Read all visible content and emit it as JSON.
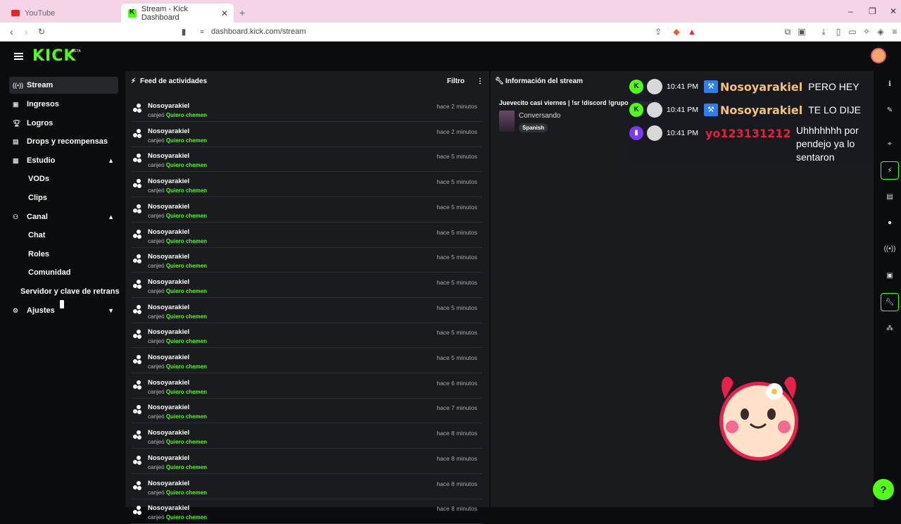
{
  "browser": {
    "tab_inactive": "YouTube",
    "tab_active": "Stream - Kick Dashboard",
    "url": "dashboard.kick.com/stream"
  },
  "header": {
    "logo": "KICK",
    "beta": "BETA"
  },
  "sidebar": {
    "items": [
      {
        "label": "Stream",
        "icon": "broadcast-icon"
      },
      {
        "label": "Ingresos",
        "icon": "money-icon"
      },
      {
        "label": "Logros",
        "icon": "trophy-icon"
      },
      {
        "label": "Drops y recompensas",
        "icon": "gift-icon"
      },
      {
        "label": "Estudio",
        "icon": "studio-icon"
      },
      {
        "label": "VODs"
      },
      {
        "label": "Clips"
      },
      {
        "label": "Canal",
        "icon": "channel-icon"
      },
      {
        "label": "Chat"
      },
      {
        "label": "Roles"
      },
      {
        "label": "Comunidad"
      },
      {
        "label": "Servidor y clave de retrans"
      },
      {
        "label": "Ajustes",
        "icon": "gear-icon"
      }
    ]
  },
  "feed": {
    "title": "Feed de actividades",
    "filter_label": "Filtro",
    "action_prefix": "canjeó",
    "reward": "Quiero chemen",
    "rows": [
      {
        "user": "Nosoyarakiel",
        "time": "hace 2 minutos"
      },
      {
        "user": "Nosoyarakiel",
        "time": "hace 2 minutos"
      },
      {
        "user": "Nosoyarakiel",
        "time": "hace 5 minutos"
      },
      {
        "user": "Nosoyarakiel",
        "time": "hace 5 minutos"
      },
      {
        "user": "Nosoyarakiel",
        "time": "hace 5 minutos"
      },
      {
        "user": "Nosoyarakiel",
        "time": "hace 5 minutos"
      },
      {
        "user": "Nosoyarakiel",
        "time": "hace 5 minutos"
      },
      {
        "user": "Nosoyarakiel",
        "time": "hace 5 minutos"
      },
      {
        "user": "Nosoyarakiel",
        "time": "hace 5 minutos"
      },
      {
        "user": "Nosoyarakiel",
        "time": "hace 5 minutos"
      },
      {
        "user": "Nosoyarakiel",
        "time": "hace 5 minutos"
      },
      {
        "user": "Nosoyarakiel",
        "time": "hace 6 minutos"
      },
      {
        "user": "Nosoyarakiel",
        "time": "hace 7 minutos"
      },
      {
        "user": "Nosoyarakiel",
        "time": "hace 8 minutos"
      },
      {
        "user": "Nosoyarakiel",
        "time": "hace 8 minutos"
      },
      {
        "user": "Nosoyarakiel",
        "time": "hace 8 minutos"
      },
      {
        "user": "Nosoyarakiel",
        "time": "hace 8 minutos"
      }
    ]
  },
  "stream_info": {
    "title": "Información del stream",
    "stream_title": "Juevecito casi viernes | !sr !discord !grupo !comands",
    "category": "Conversando",
    "language": "Spanish"
  },
  "chat_overlay": {
    "messages": [
      {
        "time": "10:41 PM",
        "user": "Nosoyarakiel",
        "text": "PERO HEY",
        "platform": "kick"
      },
      {
        "time": "10:41 PM",
        "user": "Nosoyarakiel",
        "text": "TE LO DIJE",
        "platform": "kick"
      },
      {
        "time": "10:41 PM",
        "user": "yo123131212",
        "text": "Uhhhhhhh por pendejo ya lo sentaron",
        "platform": "twitch"
      }
    ]
  },
  "colors": {
    "accent": "#53fc18",
    "bg": "#0b0c0d",
    "panel": "#191b1f"
  }
}
